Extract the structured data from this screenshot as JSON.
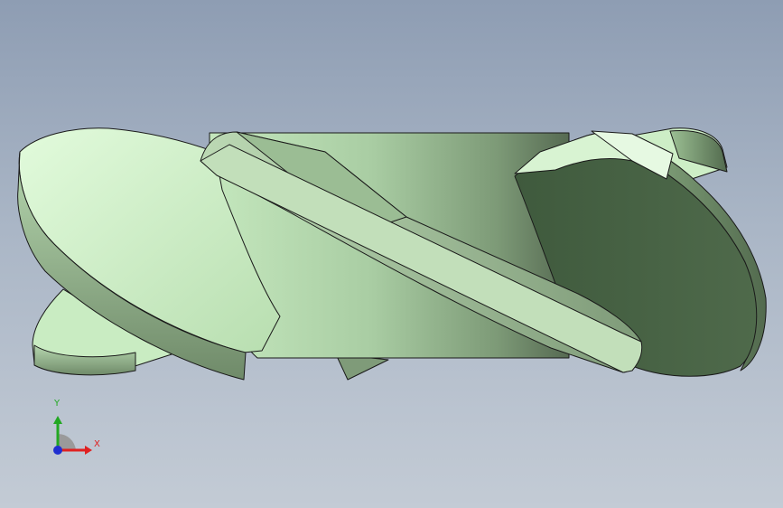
{
  "viewport": {
    "background_top": "#8e9db3",
    "background_bottom": "#c3cbd5"
  },
  "model": {
    "description_icon": "helical-impeller-3d-model",
    "surface_color": "#c6e8c0",
    "edge_color": "#1a1a1a"
  },
  "triad": {
    "y_label": "Y",
    "x_label": "X",
    "y_color": "#22a822",
    "x_color": "#e02020",
    "z_color": "#1f2fd0"
  }
}
